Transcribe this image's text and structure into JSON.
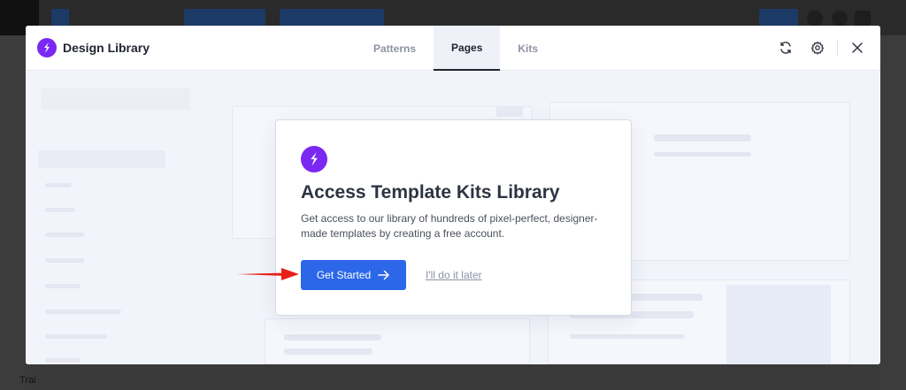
{
  "header": {
    "brand_name": "Design Library",
    "tabs": [
      {
        "label": "Patterns",
        "active": false
      },
      {
        "label": "Pages",
        "active": true
      },
      {
        "label": "Kits",
        "active": false
      }
    ],
    "icons": [
      "refresh-icon",
      "gear-icon",
      "close-icon"
    ]
  },
  "dialog": {
    "title": "Access Template Kits Library",
    "description": "Get access to our library of hundreds of pixel-perfect, designer-made templates by creating a free account.",
    "primary_button": "Get Started",
    "secondary_link": "I'll do it later"
  },
  "background": {
    "bottom_text": "Trai"
  },
  "colors": {
    "brand_purple": "#7a28f2",
    "primary_blue": "#2b67e8",
    "annotation_red": "#e8201a",
    "active_tab_bg": "#eef1f8"
  }
}
